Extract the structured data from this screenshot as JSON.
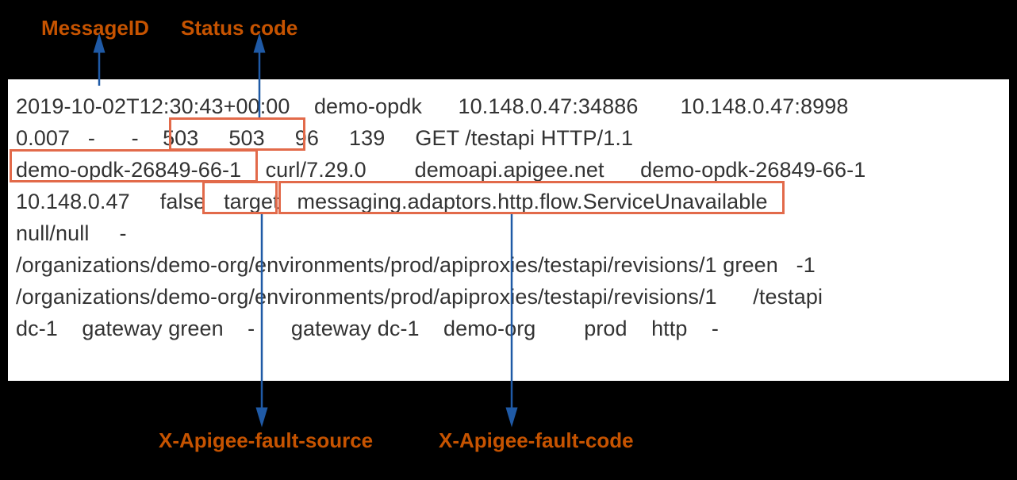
{
  "labels": {
    "messageId": "MessageID",
    "statusCode": "Status code",
    "faultSource": "X-Apigee-fault-source",
    "faultCode": "X-Apigee-fault-code"
  },
  "log": {
    "line1": "2019-10-02T12:30:43+00:00    demo-opdk      10.148.0.47:34886       10.148.0.47:8998",
    "line2": "0.007   -      -    503     503     96     139     GET /testapi HTTP/1.1",
    "line3": "demo-opdk-26849-66-1    curl/7.29.0        demoapi.apigee.net      demo-opdk-26849-66-1",
    "line4": "10.148.0.47     false   target   messaging.adaptors.http.flow.ServiceUnavailable",
    "line5": "null/null     -",
    "line6": "/organizations/demo-org/environments/prod/apiproxies/testapi/revisions/1 green   -1",
    "line7": "/organizations/demo-org/environments/prod/apiproxies/testapi/revisions/1      /testapi",
    "line8": "dc-1    gateway green    -      gateway dc-1    demo-org        prod    http    -"
  }
}
